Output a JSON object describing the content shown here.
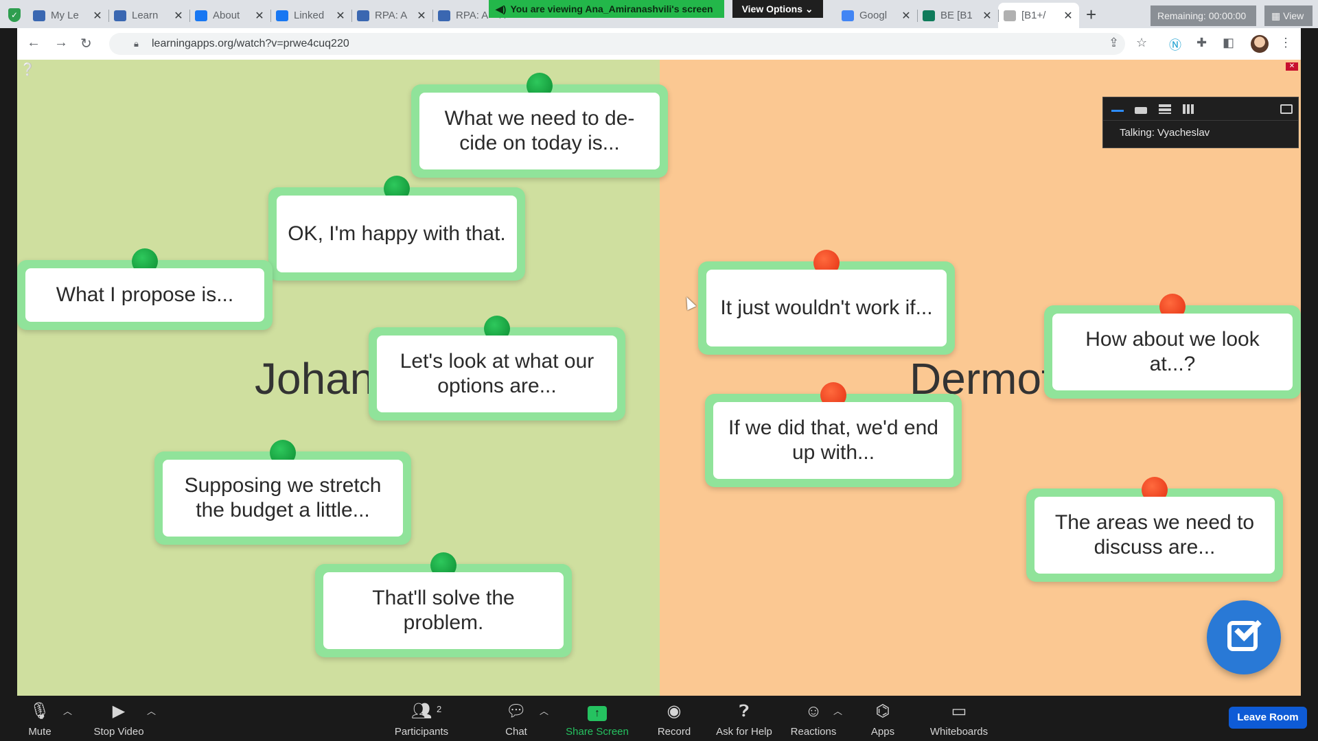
{
  "browser": {
    "tabs": [
      {
        "title": "My Le",
        "color": "#3a67b1"
      },
      {
        "title": "Learn",
        "color": "#3a67b1"
      },
      {
        "title": "About",
        "color": "#1877f2"
      },
      {
        "title": "Linked",
        "color": "#1877f2"
      },
      {
        "title": "RPA: A",
        "color": "#3a67b1"
      },
      {
        "title": "RPA: A",
        "color": "#3a67b1"
      },
      {
        "title": "Googl",
        "color": "#4285f4"
      },
      {
        "title": "BE [B1",
        "color": "#0f7b5b"
      },
      {
        "title": "[B1+/",
        "color": "#b0b0b0"
      }
    ],
    "url": "learningapps.org/watch?v=prwe4cuq220"
  },
  "zoom": {
    "banner_text": "You are viewing Ana_Amiranashvili's screen",
    "view_options": "View Options",
    "remaining": "Remaining: 00:00:00",
    "view_label": "View",
    "talking": "Talking: Vyacheslav",
    "toolbar": {
      "mute": "Mute",
      "stop_video": "Stop Video",
      "participants": "Participants",
      "participants_count": "2",
      "chat": "Chat",
      "share_screen": "Share Screen",
      "record": "Record",
      "ask_for_help": "Ask for Help",
      "reactions": "Reactions",
      "apps": "Apps",
      "whiteboards": "Whiteboards",
      "leave_room": "Leave Room"
    }
  },
  "board": {
    "left_label": "Johan",
    "right_label": "Dermot",
    "left_color": "#cfdf9f",
    "right_color": "#fbc892",
    "cards": [
      {
        "text": "What we need to de-cide on today is...",
        "pin": "green"
      },
      {
        "text": "OK, I'm happy with that.",
        "pin": "green"
      },
      {
        "text": "What I propose is...",
        "pin": "green"
      },
      {
        "text": "Let's look at what our options are...",
        "pin": "green"
      },
      {
        "text": "Supposing we stretch the budget a little...",
        "pin": "green"
      },
      {
        "text": "That'll solve the problem.",
        "pin": "green"
      },
      {
        "text": "It just wouldn't work if...",
        "pin": "red"
      },
      {
        "text": "How about we look at...?",
        "pin": "red"
      },
      {
        "text": "If we did that, we'd end up with...",
        "pin": "red"
      },
      {
        "text": "The areas we need to discuss are...",
        "pin": "red"
      }
    ]
  }
}
